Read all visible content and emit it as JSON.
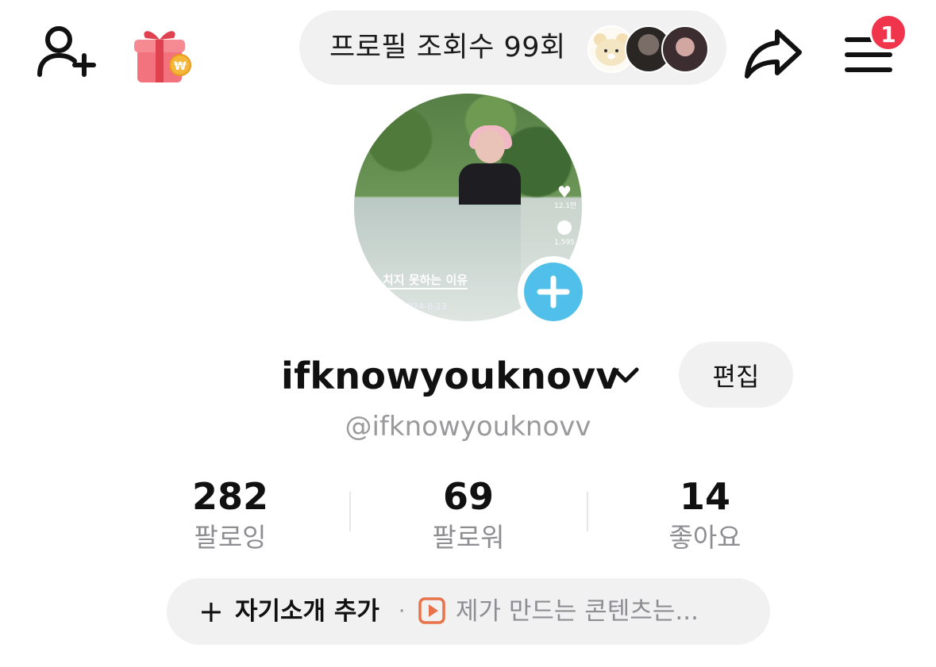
{
  "topbar": {
    "profile_views_text": "프로필 조회수 99회",
    "notification_count": "1"
  },
  "avatar": {
    "caption": "치지 못하는 이유",
    "meta": "2024-8-23",
    "side_count_1": "12.1만",
    "side_count_2": "1,595"
  },
  "profile": {
    "display_name": "ifknowyouknovv",
    "handle": "@ifknowyouknovv",
    "edit_label": "편집"
  },
  "stats": [
    {
      "value": "282",
      "label": "팔로잉"
    },
    {
      "value": "69",
      "label": "팔로워"
    },
    {
      "value": "14",
      "label": "좋아요"
    }
  ],
  "bio": {
    "plus": "+",
    "add_label": "자기소개 추가",
    "separator": "·",
    "content_text": "제가 만드는 콘텐츠는..."
  },
  "colors": {
    "badge": "#f0344c",
    "add_photo": "#50c0ea",
    "pill_bg": "#f1f1f2",
    "content_icon": "#e8734a"
  },
  "icons": [
    "add-friend-icon",
    "gift-icon",
    "share-icon",
    "menu-icon",
    "chevron-down-icon",
    "plus-icon",
    "play-icon"
  ]
}
